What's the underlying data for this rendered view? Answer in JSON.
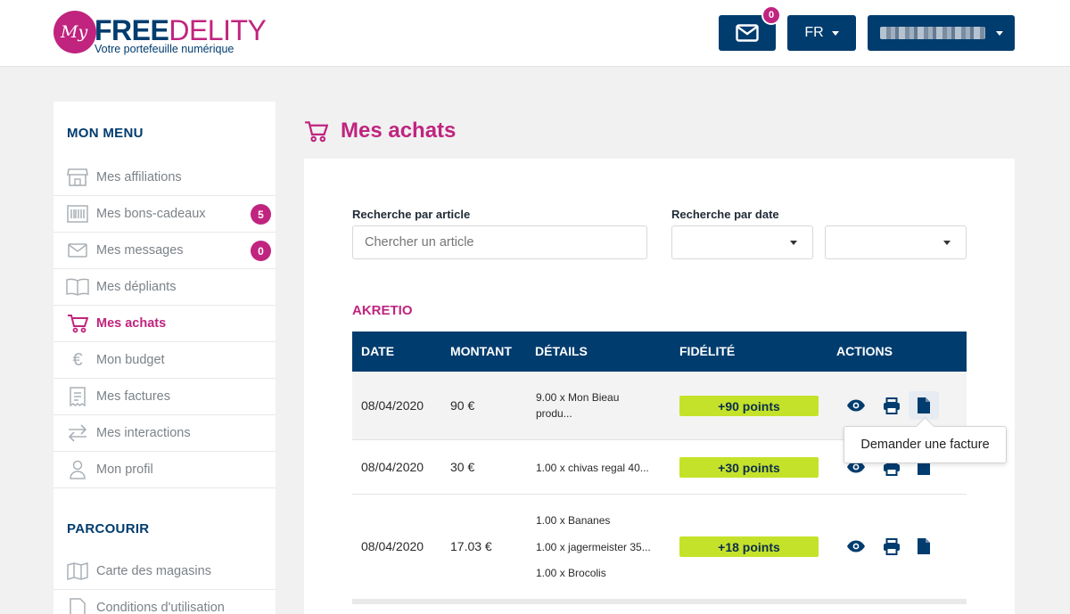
{
  "header": {
    "logo_my": "My",
    "logo_free": "FREE",
    "logo_delity": "DELITY",
    "logo_tagline": "Votre portefeuille numérique",
    "mail_badge": "0",
    "language": "FR"
  },
  "sidebar": {
    "menu_title": "MON MENU",
    "items": [
      {
        "label": "Mes affiliations",
        "icon": "store-icon"
      },
      {
        "label": "Mes bons-cadeaux",
        "icon": "barcode-icon",
        "badge": "5"
      },
      {
        "label": "Mes messages",
        "icon": "envelope-icon",
        "badge": "0"
      },
      {
        "label": "Mes dépliants",
        "icon": "book-icon"
      },
      {
        "label": "Mes achats",
        "icon": "cart-icon",
        "active": true
      },
      {
        "label": "Mon budget",
        "icon": "euro-icon"
      },
      {
        "label": "Mes factures",
        "icon": "invoice-icon"
      },
      {
        "label": "Mes interactions",
        "icon": "exchange-icon"
      },
      {
        "label": "Mon profil",
        "icon": "user-icon"
      }
    ],
    "browse_title": "PARCOURIR",
    "browse_items": [
      {
        "label": "Carte des magasins",
        "icon": "map-icon"
      },
      {
        "label": "Conditions d'utilisation",
        "icon": "document-icon"
      }
    ]
  },
  "main": {
    "title": "Mes achats",
    "search_article_label": "Recherche par article",
    "search_article_placeholder": "Chercher un article",
    "search_date_label": "Recherche par date",
    "store_name": "AKRETIO",
    "table": {
      "headers": {
        "date": "DATE",
        "montant": "MONTANT",
        "details": "DÉTAILS",
        "fidelite": "FIDÉLITÉ",
        "actions": "ACTIONS"
      },
      "rows": [
        {
          "date": "08/04/2020",
          "montant": "90 €",
          "details": [
            "9.00 x Mon Bieau",
            "produ..."
          ],
          "points": "+90 points"
        },
        {
          "date": "08/04/2020",
          "montant": "30 €",
          "details": [
            "1.00 x chivas regal 40..."
          ],
          "points": "+30 points"
        },
        {
          "date": "08/04/2020",
          "montant": "17.03 €",
          "details": [
            "1.00 x Bananes",
            "1.00 x jagermeister 35...",
            "1.00 x Brocolis"
          ],
          "points": "+18 points"
        }
      ]
    },
    "tooltip": "Demander une facture"
  },
  "colors": {
    "primary": "#003c6e",
    "accent": "#c0247f",
    "points": "#c5e22a"
  }
}
